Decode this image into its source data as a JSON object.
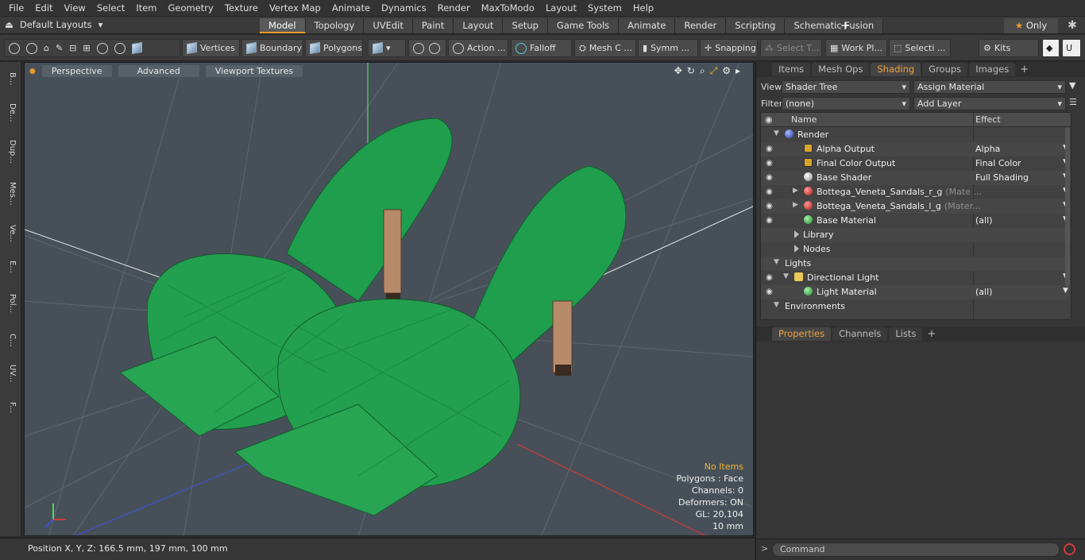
{
  "menu": [
    "File",
    "Edit",
    "View",
    "Select",
    "Item",
    "Geometry",
    "Texture",
    "Vertex Map",
    "Animate",
    "Dynamics",
    "Render",
    "MaxToModo",
    "Layout",
    "System",
    "Help"
  ],
  "layouts_label": "Default Layouts",
  "mode_tabs": [
    {
      "label": "Model",
      "active": true
    },
    {
      "label": "Topology"
    },
    {
      "label": "UVEdit"
    },
    {
      "label": "Paint"
    },
    {
      "label": "Layout"
    },
    {
      "label": "Setup"
    },
    {
      "label": "Game Tools"
    },
    {
      "label": "Animate"
    },
    {
      "label": "Render"
    },
    {
      "label": "Scripting"
    },
    {
      "label": "Schematic Fusion"
    }
  ],
  "only_label": "Only",
  "toolbar": {
    "vertices": "Vertices",
    "boundary": "Boundary",
    "polygons": "Polygons",
    "action": "Action ...",
    "falloff": "Falloff",
    "mesh": "Mesh C ...",
    "symm": "Symm ...",
    "snapping": "Snapping",
    "select_t": "Select T...",
    "workpl": "Work Pl...",
    "selecti": "Selecti ...",
    "kits": "Kits"
  },
  "left_tabs": [
    "B...",
    "De...",
    "Dup...",
    "Mes...",
    "Ve...",
    "E...",
    "Pol...",
    "C...",
    "UV...",
    "F..."
  ],
  "viewport": {
    "perspective": "Perspective",
    "advanced": "Advanced",
    "textures": "Viewport Textures",
    "stats": [
      "No Items",
      "Polygons : Face",
      "Channels: 0",
      "Deformers: ON",
      "GL: 20,104",
      "10 mm"
    ]
  },
  "status": "Position X, Y, Z:   166.5 mm, 197 mm, 100 mm",
  "panel": {
    "tabs": [
      {
        "label": "Items"
      },
      {
        "label": "Mesh Ops"
      },
      {
        "label": "Shading",
        "active": true
      },
      {
        "label": "Groups"
      },
      {
        "label": "Images"
      }
    ],
    "view_label": "View",
    "view_value": "Shader Tree",
    "assign": "Assign Material",
    "filter_label": "Filter",
    "filter_value": "(none)",
    "add_layer": "Add Layer",
    "col_name": "Name",
    "col_effect": "Effect",
    "rows": [
      {
        "name": "Render",
        "effect": "",
        "icon": "blue",
        "indent": 0,
        "eye": false,
        "toggle": "▼"
      },
      {
        "name": "Alpha Output",
        "effect": "Alpha",
        "icon": "img",
        "indent": 2,
        "eye": true
      },
      {
        "name": "Final Color Output",
        "effect": "Final Color",
        "icon": "img",
        "indent": 2,
        "eye": true
      },
      {
        "name": "Base Shader",
        "effect": "Full Shading",
        "icon": "gray",
        "indent": 2,
        "eye": true
      },
      {
        "name": "Bottega_Veneta_Sandals_r_g",
        "suffix": "(Mate ...",
        "effect": "",
        "icon": "red",
        "indent": 2,
        "eye": true,
        "toggle": "▶"
      },
      {
        "name": "Bottega_Veneta_Sandals_l_g",
        "suffix": "(Mater...",
        "effect": "",
        "icon": "red",
        "indent": 2,
        "eye": true,
        "toggle": "▶"
      },
      {
        "name": "Base Material",
        "effect": "(all)",
        "icon": "green",
        "indent": 2,
        "eye": true
      },
      {
        "name": "Library",
        "effect": "",
        "icon": "fold",
        "indent": 1,
        "eye": false
      },
      {
        "name": "Nodes",
        "effect": "",
        "icon": "fold",
        "indent": 1,
        "eye": false
      },
      {
        "name": "Lights",
        "effect": "",
        "icon": "",
        "indent": 0,
        "eye": false,
        "toggle": "▼"
      },
      {
        "name": "Directional Light",
        "effect": "",
        "icon": "light",
        "indent": 1,
        "eye": true,
        "toggle": "▼"
      },
      {
        "name": "Light Material",
        "effect": "(all)",
        "icon": "green",
        "indent": 2,
        "eye": true
      },
      {
        "name": "Environments",
        "effect": "",
        "icon": "",
        "indent": 0,
        "eye": false,
        "toggle": "▼"
      }
    ],
    "bottom_tabs": [
      {
        "label": "Properties",
        "active": true
      },
      {
        "label": "Channels"
      },
      {
        "label": "Lists"
      }
    ],
    "command_placeholder": "Command"
  }
}
